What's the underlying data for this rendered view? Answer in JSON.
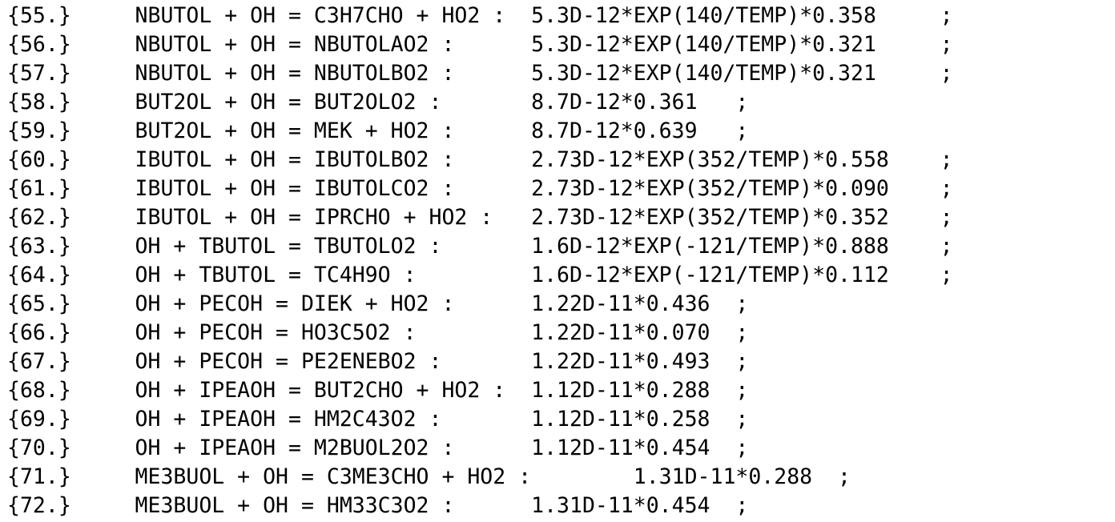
{
  "lines": [
    "{55.}     NBUTOL + OH = C3H7CHO + HO2 :  5.3D-12*EXP(140/TEMP)*0.358     ;",
    "{56.}     NBUTOL + OH = NBUTOLAO2 :      5.3D-12*EXP(140/TEMP)*0.321     ;",
    "{57.}     NBUTOL + OH = NBUTOLBO2 :      5.3D-12*EXP(140/TEMP)*0.321     ;",
    "{58.}     BUT2OL + OH = BUT2OLO2 :       8.7D-12*0.361   ;",
    "{59.}     BUT2OL + OH = MEK + HO2 :      8.7D-12*0.639   ;",
    "{60.}     IBUTOL + OH = IBUTOLBO2 :      2.73D-12*EXP(352/TEMP)*0.558    ;",
    "{61.}     IBUTOL + OH = IBUTOLCO2 :      2.73D-12*EXP(352/TEMP)*0.090    ;",
    "{62.}     IBUTOL + OH = IPRCHO + HO2 :   2.73D-12*EXP(352/TEMP)*0.352    ;",
    "{63.}     OH + TBUTOL = TBUTOLO2 :       1.6D-12*EXP(-121/TEMP)*0.888    ;",
    "{64.}     OH + TBUTOL = TC4H9O :         1.6D-12*EXP(-121/TEMP)*0.112    ;",
    "{65.}     OH + PECOH = DIEK + HO2 :      1.22D-11*0.436  ;",
    "{66.}     OH + PECOH = HO3C5O2 :         1.22D-11*0.070  ;",
    "{67.}     OH + PECOH = PE2ENEBO2 :       1.22D-11*0.493  ;",
    "{68.}     OH + IPEAOH = BUT2CHO + HO2 :  1.12D-11*0.288  ;",
    "{69.}     OH + IPEAOH = HM2C43O2 :       1.12D-11*0.258  ;",
    "{70.}     OH + IPEAOH = M2BUOL2O2 :      1.12D-11*0.454  ;",
    "{71.}     ME3BUOL + OH = C3ME3CHO + HO2 :        1.31D-11*0.288  ;",
    "{72.}     ME3BUOL + OH = HM33C3O2 :      1.31D-11*0.454  ;"
  ]
}
